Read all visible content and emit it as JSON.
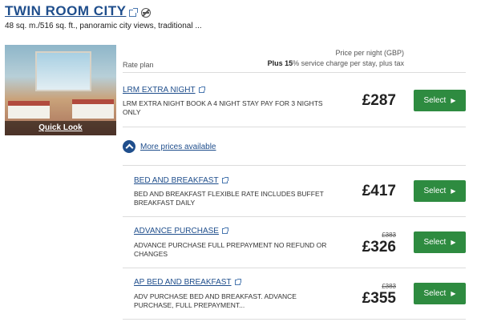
{
  "room": {
    "title": "TWIN ROOM CITY",
    "description": "48 sq. m./516 sq. ft., panoramic city views, traditional ...",
    "quick_look_label": "Quick Look"
  },
  "table_header": {
    "rate_plan_label": "Rate plan",
    "price_per_night_label": "Price per night (GBP)",
    "service_charge_bold": "Plus 15",
    "service_charge_rest": "% service charge per stay, plus tax"
  },
  "more_prices_label": "More prices available",
  "rates": [
    {
      "name": "LRM EXTRA NIGHT",
      "desc_line1": "LRM EXTRA NIGHT BOOK A 4 NIGHT STAY PAY FOR 3 NIGHTS",
      "desc_line2": "ONLY",
      "old_price": "",
      "price": "£287",
      "select_label": "Select"
    },
    {
      "name": "BED AND BREAKFAST",
      "desc_line1": "BED AND BREAKFAST FLEXIBLE RATE INCLUDES BUFFET",
      "desc_line2": "BREAKFAST DAILY",
      "old_price": "",
      "price": "£417",
      "select_label": "Select"
    },
    {
      "name": "ADVANCE PURCHASE",
      "desc_line1": "ADVANCE PURCHASE FULL PREPAYMENT NO REFUND OR",
      "desc_line2": "CHANGES",
      "old_price": "£383",
      "price": "£326",
      "select_label": "Select"
    },
    {
      "name": "AP BED AND BREAKFAST",
      "desc_line1": "ADV PURCHASE BED AND BREAKFAST. ADVANCE",
      "desc_line2": "PURCHASE, FULL PREPAYMENT...",
      "old_price": "£383",
      "price": "£355",
      "select_label": "Select"
    }
  ],
  "colors": {
    "link_blue": "#1f4e8c",
    "select_green": "#2e8b40"
  },
  "icons": {
    "external_link": "external-link-icon",
    "no_smoking": "no-smoking-icon",
    "chevron_up": "chevron-up-icon",
    "chevron_right": "chevron-right-icon"
  }
}
